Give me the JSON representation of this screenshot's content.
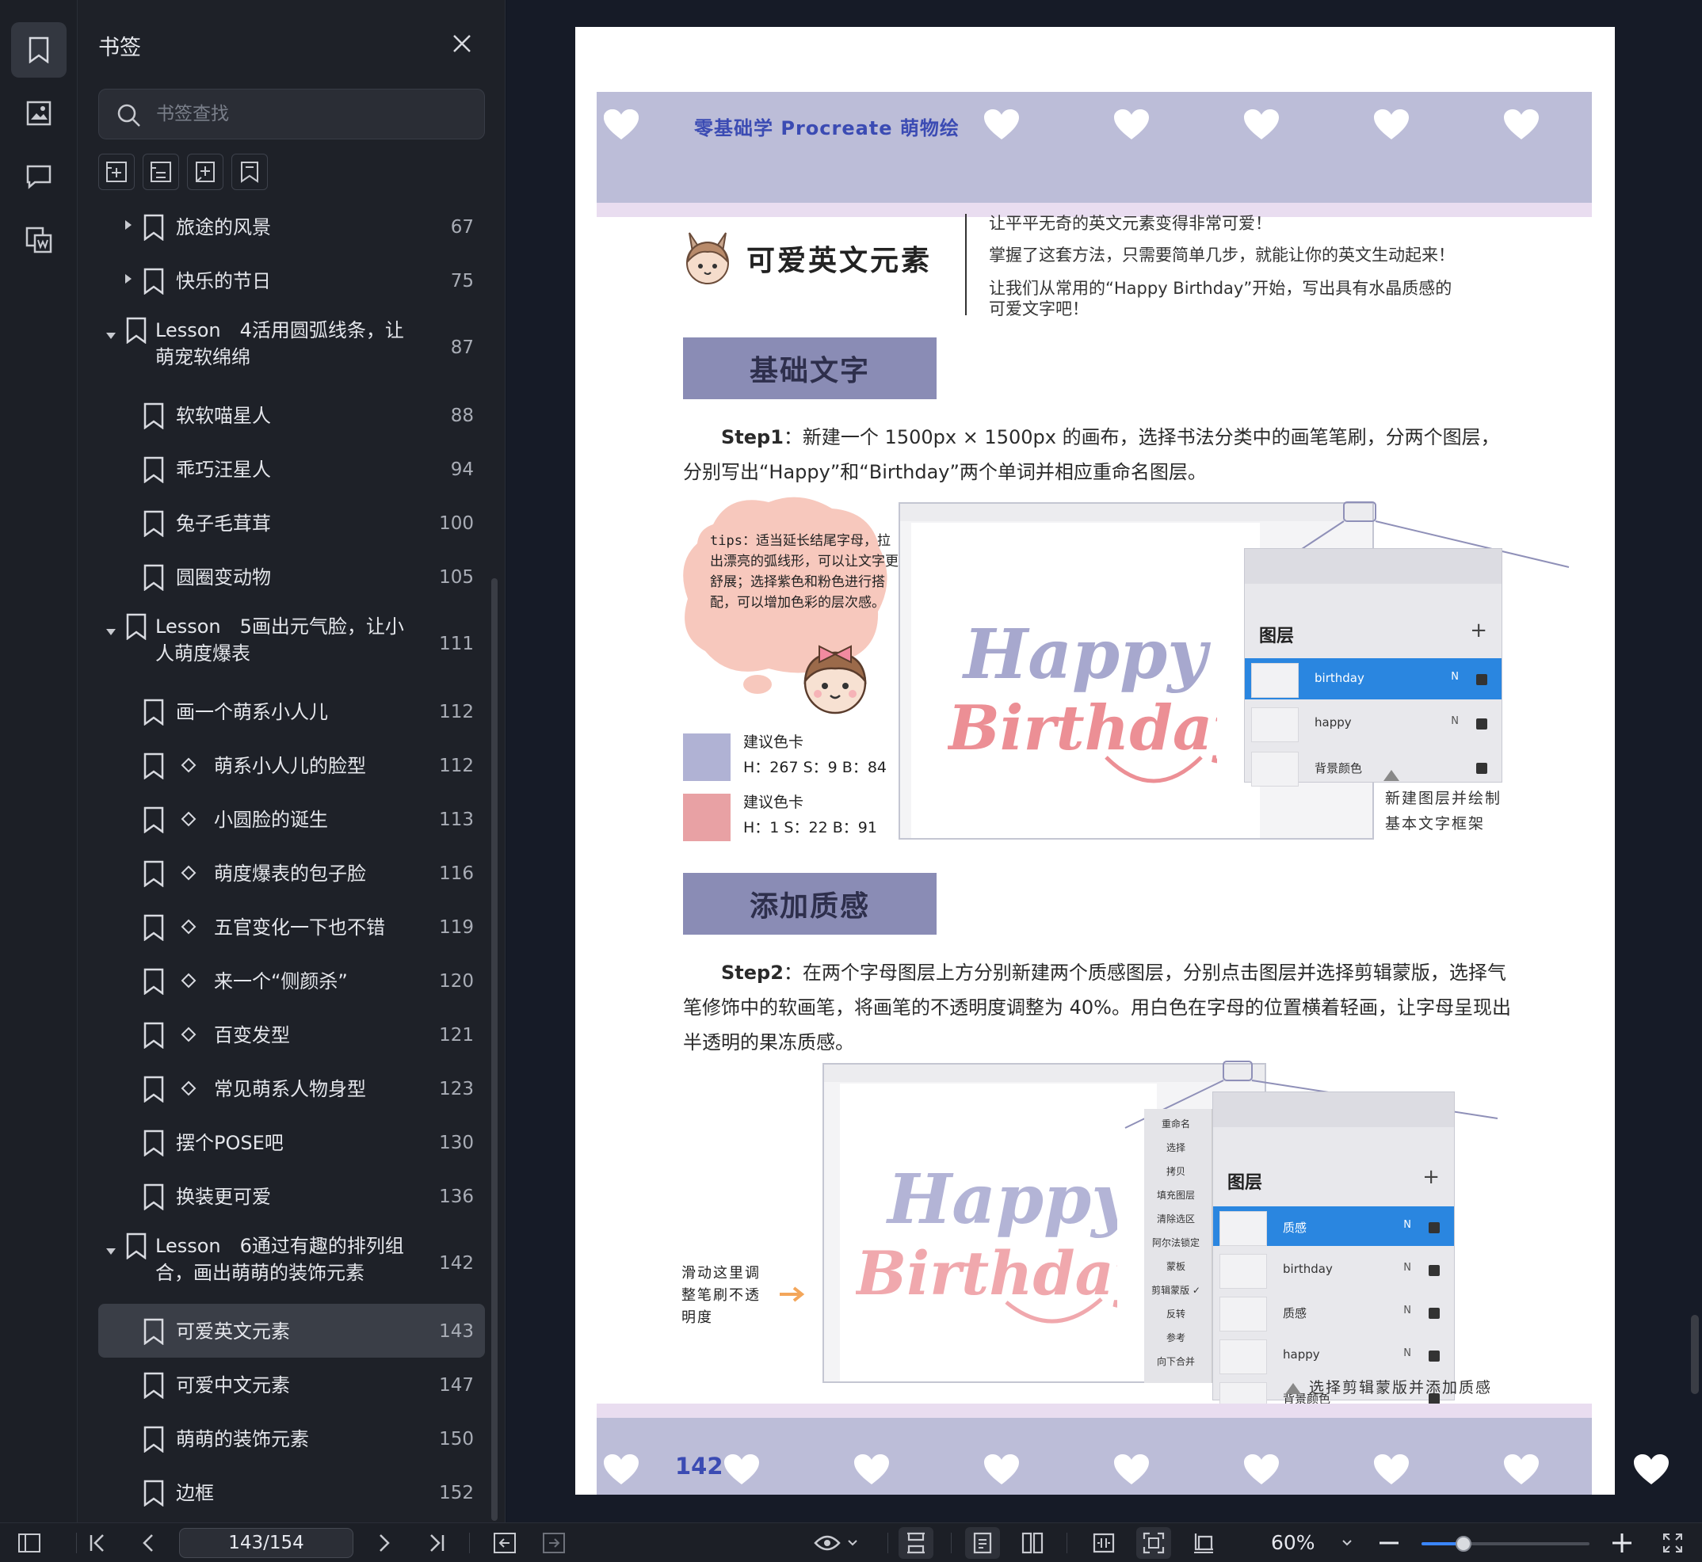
{
  "panel": {
    "title": "书签",
    "search_placeholder": "书签查找"
  },
  "bookmarks": [
    {
      "label": "旅途的风景",
      "page": "67",
      "level": 1,
      "arrow": "right",
      "lines": 1
    },
    {
      "label": "快乐的节日",
      "page": "75",
      "level": 1,
      "arrow": "right",
      "lines": 1
    },
    {
      "label": "Lesson　4活用圆弧线条，让萌宠软绵绵",
      "page": "87",
      "level": 0,
      "arrow": "down",
      "lines": 2
    },
    {
      "label": "软软喵星人",
      "page": "88",
      "level": 1,
      "lines": 1
    },
    {
      "label": "乖巧汪星人",
      "page": "94",
      "level": 1,
      "lines": 1
    },
    {
      "label": "兔子毛茸茸",
      "page": "100",
      "level": 1,
      "lines": 1
    },
    {
      "label": "圆圈变动物",
      "page": "105",
      "level": 1,
      "lines": 1
    },
    {
      "label": "Lesson　5画出元气脸，让小人萌度爆表",
      "page": "111",
      "level": 0,
      "arrow": "down",
      "lines": 2
    },
    {
      "label": "画一个萌系小人儿",
      "page": "112",
      "level": 1,
      "lines": 1
    },
    {
      "label": "萌系小人儿的脸型",
      "page": "112",
      "level": 2,
      "lines": 1
    },
    {
      "label": "小圆脸的诞生",
      "page": "113",
      "level": 2,
      "lines": 1
    },
    {
      "label": "萌度爆表的包子脸",
      "page": "116",
      "level": 2,
      "lines": 1
    },
    {
      "label": "五官变化一下也不错",
      "page": "119",
      "level": 2,
      "lines": 1
    },
    {
      "label": "来一个“侧颜杀”",
      "page": "120",
      "level": 2,
      "lines": 1
    },
    {
      "label": "百变发型",
      "page": "121",
      "level": 2,
      "lines": 1
    },
    {
      "label": "常见萌系人物身型",
      "page": "123",
      "level": 2,
      "lines": 1
    },
    {
      "label": "摆个POSE吧",
      "page": "130",
      "level": 1,
      "lines": 1
    },
    {
      "label": "换装更可爱",
      "page": "136",
      "level": 1,
      "lines": 1
    },
    {
      "label": "Lesson　6通过有趣的排列组合，画出萌萌的装饰元素",
      "page": "142",
      "level": 0,
      "arrow": "down",
      "lines": 2
    },
    {
      "label": "可爱英文元素",
      "page": "143",
      "level": 1,
      "lines": 1,
      "selected": true
    },
    {
      "label": "可爱中文元素",
      "page": "147",
      "level": 1,
      "lines": 1
    },
    {
      "label": "萌萌的装饰元素",
      "page": "150",
      "level": 1,
      "lines": 1
    },
    {
      "label": "边框",
      "page": "152",
      "level": 1,
      "lines": 1
    }
  ],
  "doc": {
    "book_title": "零基础学 Procreate 萌物绘",
    "section_title": "可爱英文元素",
    "intro": [
      "让平平无奇的英文元素变得非常可爱！",
      "掌握了这套方法，只需要简单几步，就能让你的英文生动起来！",
      "让我们从常用的“Happy Birthday”开始，写出具有水晶质感的",
      "可爱文字吧！"
    ],
    "sec1": "基础文字",
    "step1_lead": "Step1",
    "step1_text": "：新建一个 1500px × 1500px 的画布，选择书法分类中的画笔笔刷，分两个图层，分别写出“Happy”和“Birthday”两个单词并相应重命名图层。",
    "tips": "tips：适当延长结尾字母，拉出漂亮的弧线形，可以让文字更舒展；选择紫色和粉色进行搭配，可以增加色彩的层次感。",
    "swatch1_title": "建议色卡",
    "swatch1_value": "H：267  S：9  B：84",
    "swatch2_title": "建议色卡",
    "swatch2_value": "H：1  S：22  B：91",
    "layers_title": "图层",
    "layers1": [
      {
        "name": "birthday",
        "n": "N",
        "active": true
      },
      {
        "name": "happy",
        "n": "N",
        "active": false
      },
      {
        "name": "背景颜色",
        "n": "",
        "active": false
      }
    ],
    "caption1": [
      "新建图层并绘制",
      "基本文字框架"
    ],
    "sec2": "添加质感",
    "step2_lead": "Step2",
    "step2_text": "：在两个字母图层上方分别新建两个质感图层，分别点击图层并选择剪辑蒙版，选择气笔修饰中的软画笔，将画笔的不透明度调整为 40%。用白色在字母的位置横着轻画，让字母呈现出半透明的果冻质感。",
    "menu": [
      "重命名",
      "选择",
      "拷贝",
      "填充图层",
      "清除选区",
      "阿尔法锁定",
      "蒙板",
      "剪辑蒙版 ✓",
      "反转",
      "参考",
      "向下合并"
    ],
    "layers2": [
      {
        "name": "质感",
        "n": "N",
        "active": true
      },
      {
        "name": "birthday",
        "n": "N",
        "active": false
      },
      {
        "name": "质感",
        "n": "N",
        "active": false
      },
      {
        "name": "happy",
        "n": "N",
        "active": false
      },
      {
        "name": "背景颜色",
        "n": "",
        "active": false
      }
    ],
    "hint_left": [
      "滑动这里调",
      "整笔刷不透",
      "明度"
    ],
    "caption2": "选择剪辑蒙版并添加质感",
    "art_word1": "Happy",
    "art_word2": "Birthday",
    "page_number": "142"
  },
  "bottombar": {
    "page_indicator": "143/154",
    "zoom": "60%",
    "zoom_fraction": 0.25
  },
  "colors": {
    "accent": "#3a86ff",
    "swatch1": "#b0b2d4",
    "swatch2": "#e8a1a4",
    "band": "#bcbdd8",
    "section_box": "#8a8cb5"
  }
}
